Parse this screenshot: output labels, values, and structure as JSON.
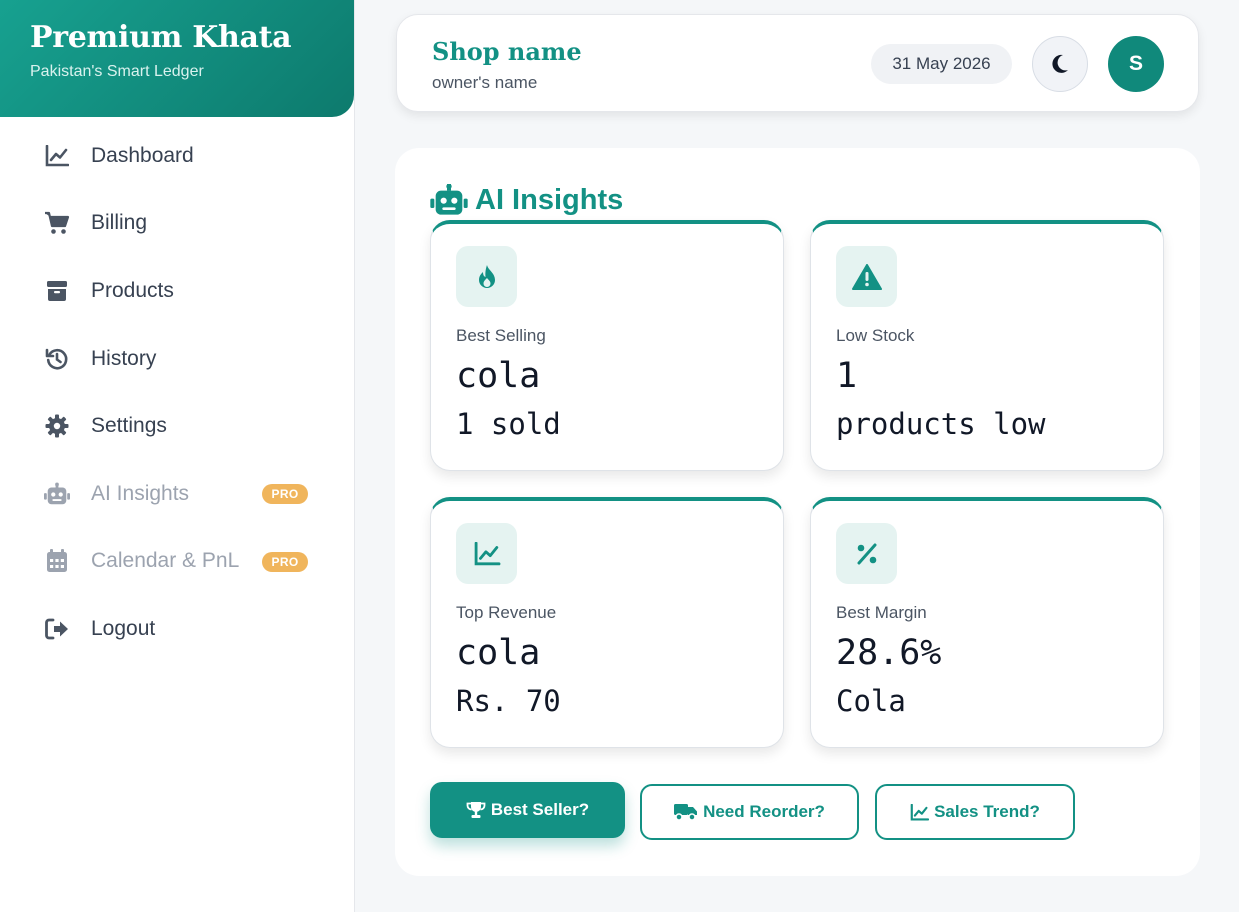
{
  "brand": {
    "title": "Premium Khata",
    "subtitle": "Pakistan's Smart Ledger"
  },
  "sidebar": {
    "items": [
      {
        "label": "Dashboard",
        "icon": "chart-line-icon"
      },
      {
        "label": "Billing",
        "icon": "cart-icon"
      },
      {
        "label": "Products",
        "icon": "box-icon"
      },
      {
        "label": "History",
        "icon": "history-icon"
      },
      {
        "label": "Settings",
        "icon": "gear-icon"
      },
      {
        "label": "AI Insights",
        "icon": "robot-icon",
        "badge": "PRO"
      },
      {
        "label": "Calendar & PnL",
        "icon": "calendar-icon",
        "badge": "PRO"
      },
      {
        "label": "Logout",
        "icon": "logout-icon"
      }
    ]
  },
  "header": {
    "shop_name": "Shop name",
    "owner_name": "owner's name",
    "date": "31 May 2026",
    "theme_icon": "moon-icon",
    "avatar_initial": "S"
  },
  "insights": {
    "title": "AI Insights",
    "title_icon": "robot-icon",
    "cards": [
      {
        "label": "Best Selling",
        "value": "cola",
        "sub": "1 sold",
        "icon": "fire-icon"
      },
      {
        "label": "Low Stock",
        "value": "1",
        "sub": "products low",
        "icon": "warning-icon"
      },
      {
        "label": "Top Revenue",
        "value": "cola",
        "sub": "Rs. 70",
        "icon": "chart-line-icon"
      },
      {
        "label": "Best Margin",
        "value": "28.6%",
        "sub": "Cola",
        "icon": "percent-icon"
      }
    ],
    "buttons": [
      {
        "label": "Best Seller?",
        "icon": "trophy-icon"
      },
      {
        "label": "Need Reorder?",
        "icon": "truck-icon"
      },
      {
        "label": "Sales Trend?",
        "icon": "chart-line-icon"
      }
    ]
  },
  "colors": {
    "accent": "#139184",
    "pro_badge": "#f0b55c",
    "background": "#f5f7f9"
  }
}
